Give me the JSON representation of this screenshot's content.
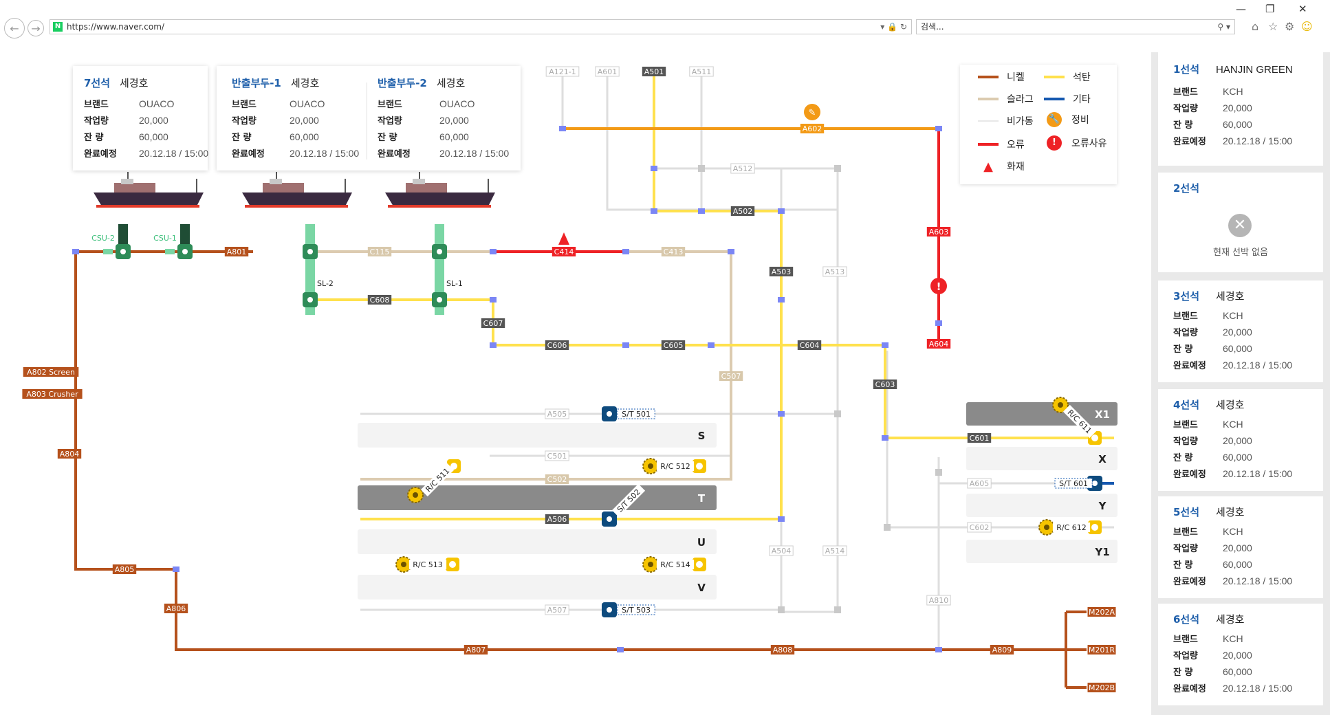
{
  "browser": {
    "url": "https://www.naver.com/",
    "search_placeholder": "검색...",
    "favicon": "N"
  },
  "top_cards": [
    {
      "berth": "7선석",
      "ship": "세경호",
      "rows": [
        [
          "브랜드",
          "OUACO"
        ],
        [
          "작업량",
          "20,000"
        ],
        [
          "잔  량",
          "60,000"
        ],
        [
          "완료예정",
          "20.12.18 / 15:00"
        ]
      ]
    },
    {
      "berth": "반출부두-1",
      "ship": "세경호",
      "rows": [
        [
          "브랜드",
          "OUACO"
        ],
        [
          "작업량",
          "20,000"
        ],
        [
          "잔  량",
          "60,000"
        ],
        [
          "완료예정",
          "20.12.18 / 15:00"
        ]
      ]
    },
    {
      "berth": "반출부두-2",
      "ship": "세경호",
      "rows": [
        [
          "브랜드",
          "OUACO"
        ],
        [
          "작업량",
          "20,000"
        ],
        [
          "잔  량",
          "60,000"
        ],
        [
          "완료예정",
          "20.12.18 / 15:00"
        ]
      ]
    }
  ],
  "right_cards": [
    {
      "berth": "1선석",
      "ship": "HANJIN GREEN",
      "rows": [
        [
          "브랜드",
          "KCH"
        ],
        [
          "작업량",
          "20,000"
        ],
        [
          "잔  량",
          "60,000"
        ],
        [
          "완료예정",
          "20.12.18 / 15:00"
        ]
      ]
    },
    {
      "berth": "2선석",
      "empty": "현재 선박 없음"
    },
    {
      "berth": "3선석",
      "ship": "세경호",
      "rows": [
        [
          "브랜드",
          "KCH"
        ],
        [
          "작업량",
          "20,000"
        ],
        [
          "잔  량",
          "60,000"
        ],
        [
          "완료예정",
          "20.12.18 / 15:00"
        ]
      ]
    },
    {
      "berth": "4선석",
      "ship": "세경호",
      "rows": [
        [
          "브랜드",
          "KCH"
        ],
        [
          "작업량",
          "20,000"
        ],
        [
          "잔  량",
          "60,000"
        ],
        [
          "완료예정",
          "20.12.18 / 15:00"
        ]
      ]
    },
    {
      "berth": "5선석",
      "ship": "세경호",
      "rows": [
        [
          "브랜드",
          "KCH"
        ],
        [
          "작업량",
          "20,000"
        ],
        [
          "잔  량",
          "60,000"
        ],
        [
          "완료예정",
          "20.12.18 / 15:00"
        ]
      ]
    },
    {
      "berth": "6선석",
      "ship": "세경호",
      "rows": [
        [
          "브랜드",
          "KCH"
        ],
        [
          "작업량",
          "20,000"
        ],
        [
          "잔  량",
          "60,000"
        ],
        [
          "완료예정",
          "20.12.18 / 15:00"
        ]
      ]
    }
  ],
  "legend": {
    "nickel": "니켈",
    "coal": "석탄",
    "slag": "슬라그",
    "other": "기타",
    "idle": "비가동",
    "maint": "정비",
    "error": "오류",
    "error_reason": "오류사유",
    "fire": "화재"
  },
  "colors": {
    "nickel": "#b5511c",
    "coal": "#ffe14d",
    "slag": "#dccbb0",
    "other": "#1558b0",
    "idle": "#dedede",
    "error": "#ee2226",
    "maint": "#f39a16",
    "junction": "#7b86f5",
    "label_dark": "#555555",
    "stacker": "#0e4b7e",
    "reclaimer": "#f6c400",
    "ship_loader": "#7ad6a4"
  },
  "conveyor_labels": {
    "A121_1": "A121-1",
    "A601": "A601",
    "A501": "A501",
    "A511": "A511",
    "A602": "A602",
    "A512": "A512",
    "A502": "A502",
    "A503": "A503",
    "A513": "A513",
    "A603": "A603",
    "A604": "A604",
    "A801": "A801",
    "A802": "A802 Screen",
    "A803": "A803 Crusher",
    "A804": "A804",
    "A805": "A805",
    "A806": "A806",
    "A807": "A807",
    "A808": "A808",
    "A809": "A809",
    "A810": "A810",
    "A505": "A505",
    "A506": "A506",
    "A507": "A507",
    "A504": "A504",
    "A514": "A514",
    "A605": "A605",
    "C115": "C115",
    "C414": "C414",
    "C413": "C413",
    "C608": "C608",
    "C607": "C607",
    "C606": "C606",
    "C605": "C605",
    "C604": "C604",
    "C603": "C603",
    "C507": "C507",
    "C501": "C501",
    "C502": "C502",
    "C601": "C601",
    "C602": "C602",
    "M202A": "M202A",
    "M201R": "M201R",
    "M202B": "M202B"
  },
  "equipment_labels": {
    "csu2": "CSU-2",
    "csu1": "CSU-1",
    "sl2": "SL-2",
    "sl1": "SL-1",
    "st501": "S/T 501",
    "st502": "S/T 502",
    "st503": "S/T 503",
    "st601": "S/T 601",
    "rc511": "R/C 511",
    "rc512": "R/C 512",
    "rc513": "R/C 513",
    "rc514": "R/C 514",
    "rc611": "R/C 611",
    "rc612": "R/C 612"
  },
  "yards": {
    "S": "S",
    "T": "T",
    "U": "U",
    "V": "V",
    "X1": "X1",
    "X": "X",
    "Y": "Y",
    "Y1": "Y1"
  }
}
